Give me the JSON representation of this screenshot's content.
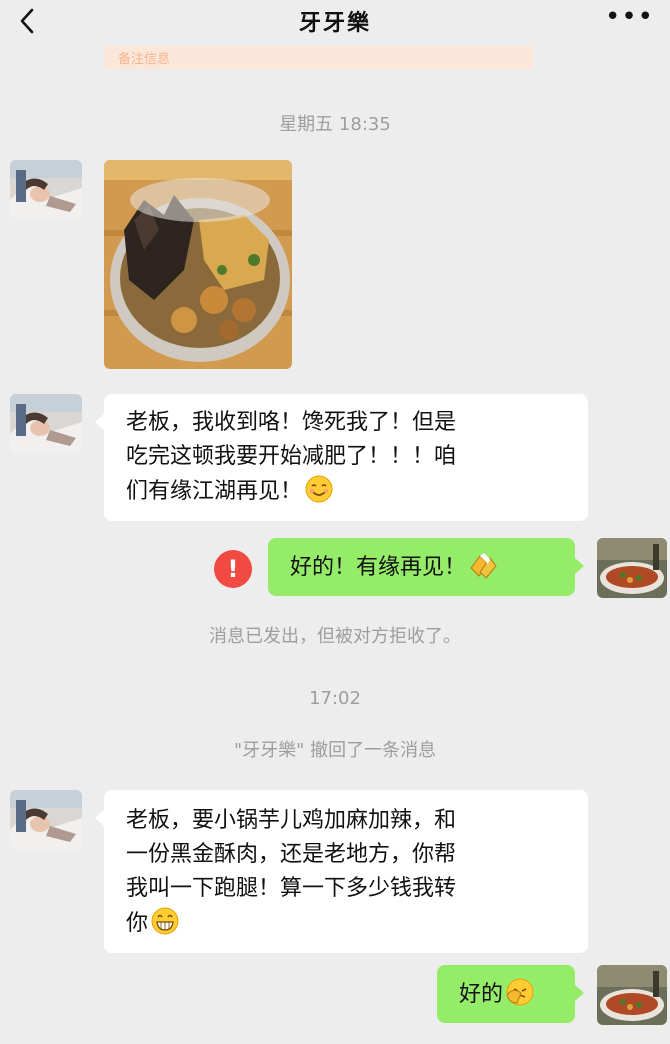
{
  "header": {
    "title": "牙牙樂",
    "more": "•••"
  },
  "banner": {
    "text": "备注信息"
  },
  "messages": {
    "time1": "星期五 18:35",
    "msg1": {
      "lines": [
        "老板，我收到咯！馋死我了！但是",
        "吃完这顿我要开始减肥了！！！咱",
        "们有缘江湖再见！"
      ]
    },
    "msg2": "好的！有缘再见！",
    "rejected": "消息已发出，但被对方拒收了。",
    "time2": "17:02",
    "recall": "\"牙牙樂\" 撤回了一条消息",
    "msg3": {
      "lines": [
        "老板，要小锅芋儿鸡加麻加辣，和",
        "一份黑金酥肉，还是老地方，你帮",
        "我叫一下跑腿！算一下多少钱我转",
        "你"
      ]
    },
    "msg4": "好的"
  },
  "icons": {
    "back": "chevron-left-icon",
    "more": "more-dots-icon",
    "error": "exclamation-icon",
    "smile": "smile-emoji-icon",
    "cheers": "beer-cheers-emoji-icon",
    "grin": "grin-emoji-icon",
    "facepalm": "facepalm-emoji-icon"
  },
  "colors": {
    "bg": "#ededed",
    "outgoing": "#95ec69",
    "incoming": "#ffffff",
    "error": "#f04a43"
  }
}
